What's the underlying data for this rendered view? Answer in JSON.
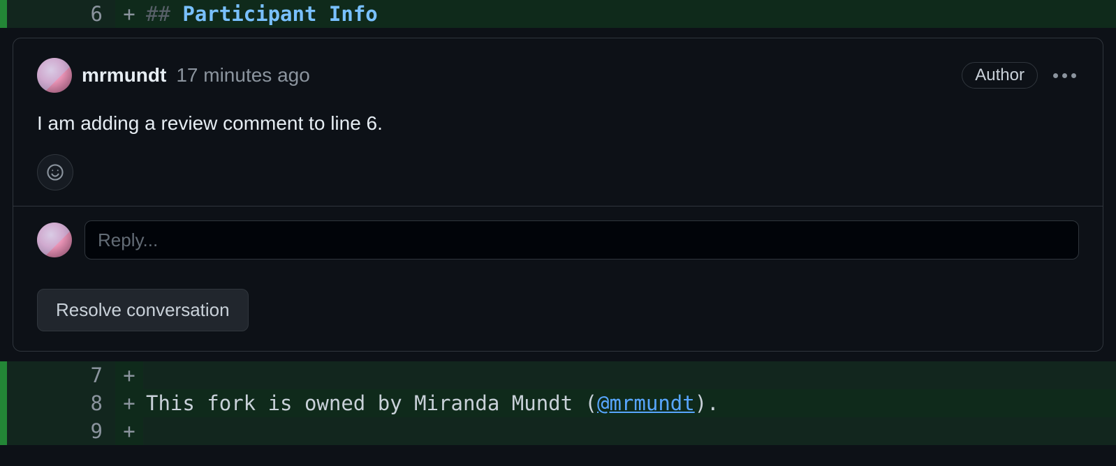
{
  "diff": {
    "lines": [
      {
        "number": "6",
        "marker": "+",
        "heading_mark": "##",
        "heading_text": " Participant Info"
      },
      {
        "number": "7",
        "marker": "+",
        "text": ""
      },
      {
        "number": "8",
        "marker": "+",
        "prefix": "This fork is owned by Miranda Mundt (",
        "mention": "@mrmundt",
        "suffix": ")."
      },
      {
        "number": "9",
        "marker": "+",
        "text": ""
      }
    ]
  },
  "comment": {
    "username": "mrmundt",
    "timestamp": "17 minutes ago",
    "author_badge": "Author",
    "body": "I am adding a review comment to line 6.",
    "reply_placeholder": "Reply...",
    "resolve_label": "Resolve conversation"
  }
}
